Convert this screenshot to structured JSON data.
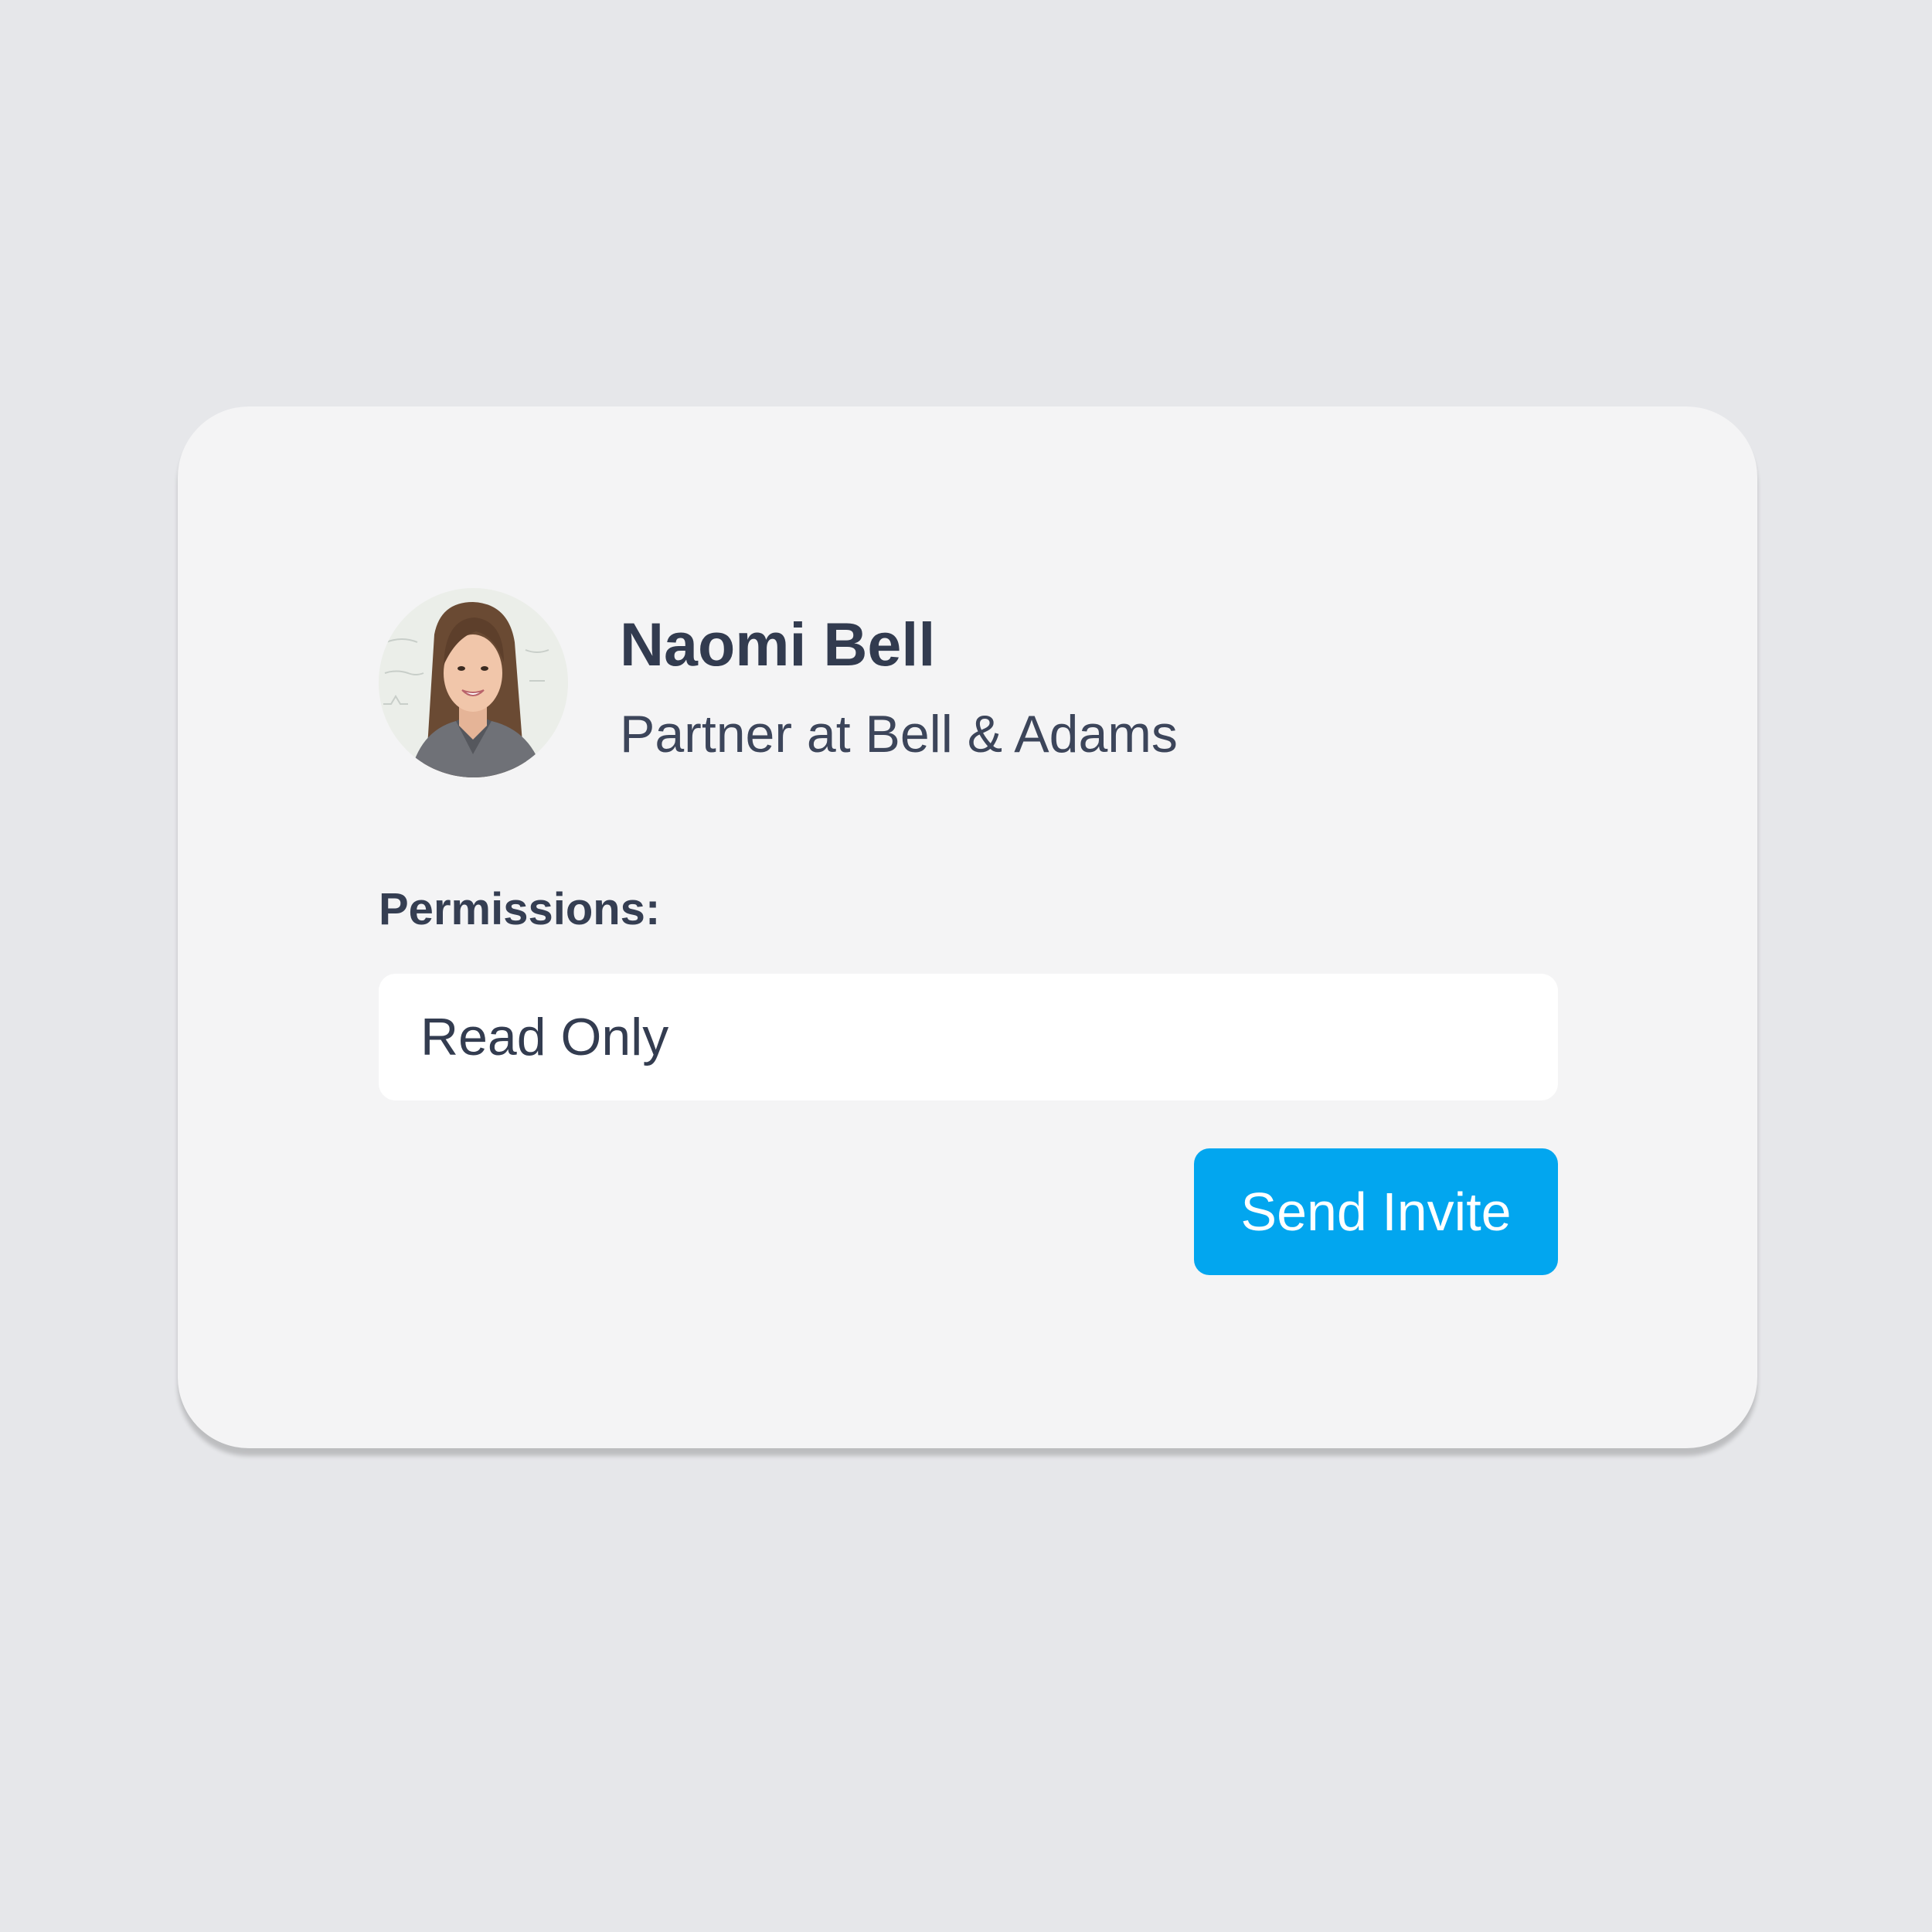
{
  "user": {
    "name": "Naomi Bell",
    "title": "Partner at Bell & Adams"
  },
  "permissions": {
    "label": "Permissions:",
    "value": "Read Only"
  },
  "actions": {
    "send_label": "Send Invite"
  },
  "colors": {
    "page_background": "#e6e7ea",
    "card_background": "#f4f4f5",
    "text_primary": "#323b4f",
    "button_accent": "#02a6ef"
  }
}
